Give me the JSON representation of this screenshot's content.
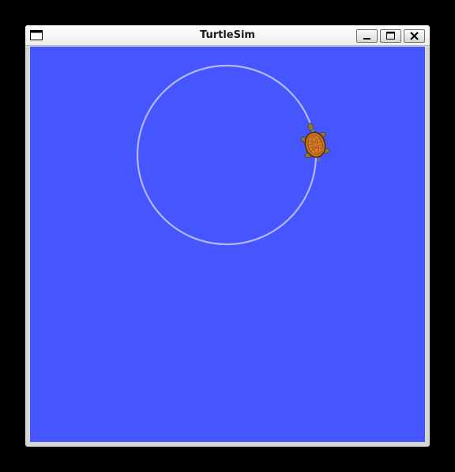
{
  "window": {
    "title": "TurtleSim",
    "controls": {
      "minimize_icon": "minimize-icon",
      "maximize_icon": "maximize-icon",
      "close_icon": "close-icon"
    }
  },
  "canvas": {
    "background_color": "#4556ff",
    "pen_color": "#b3b8ff",
    "path_shape": "circle",
    "turtle_icon": "turtle-icon"
  }
}
